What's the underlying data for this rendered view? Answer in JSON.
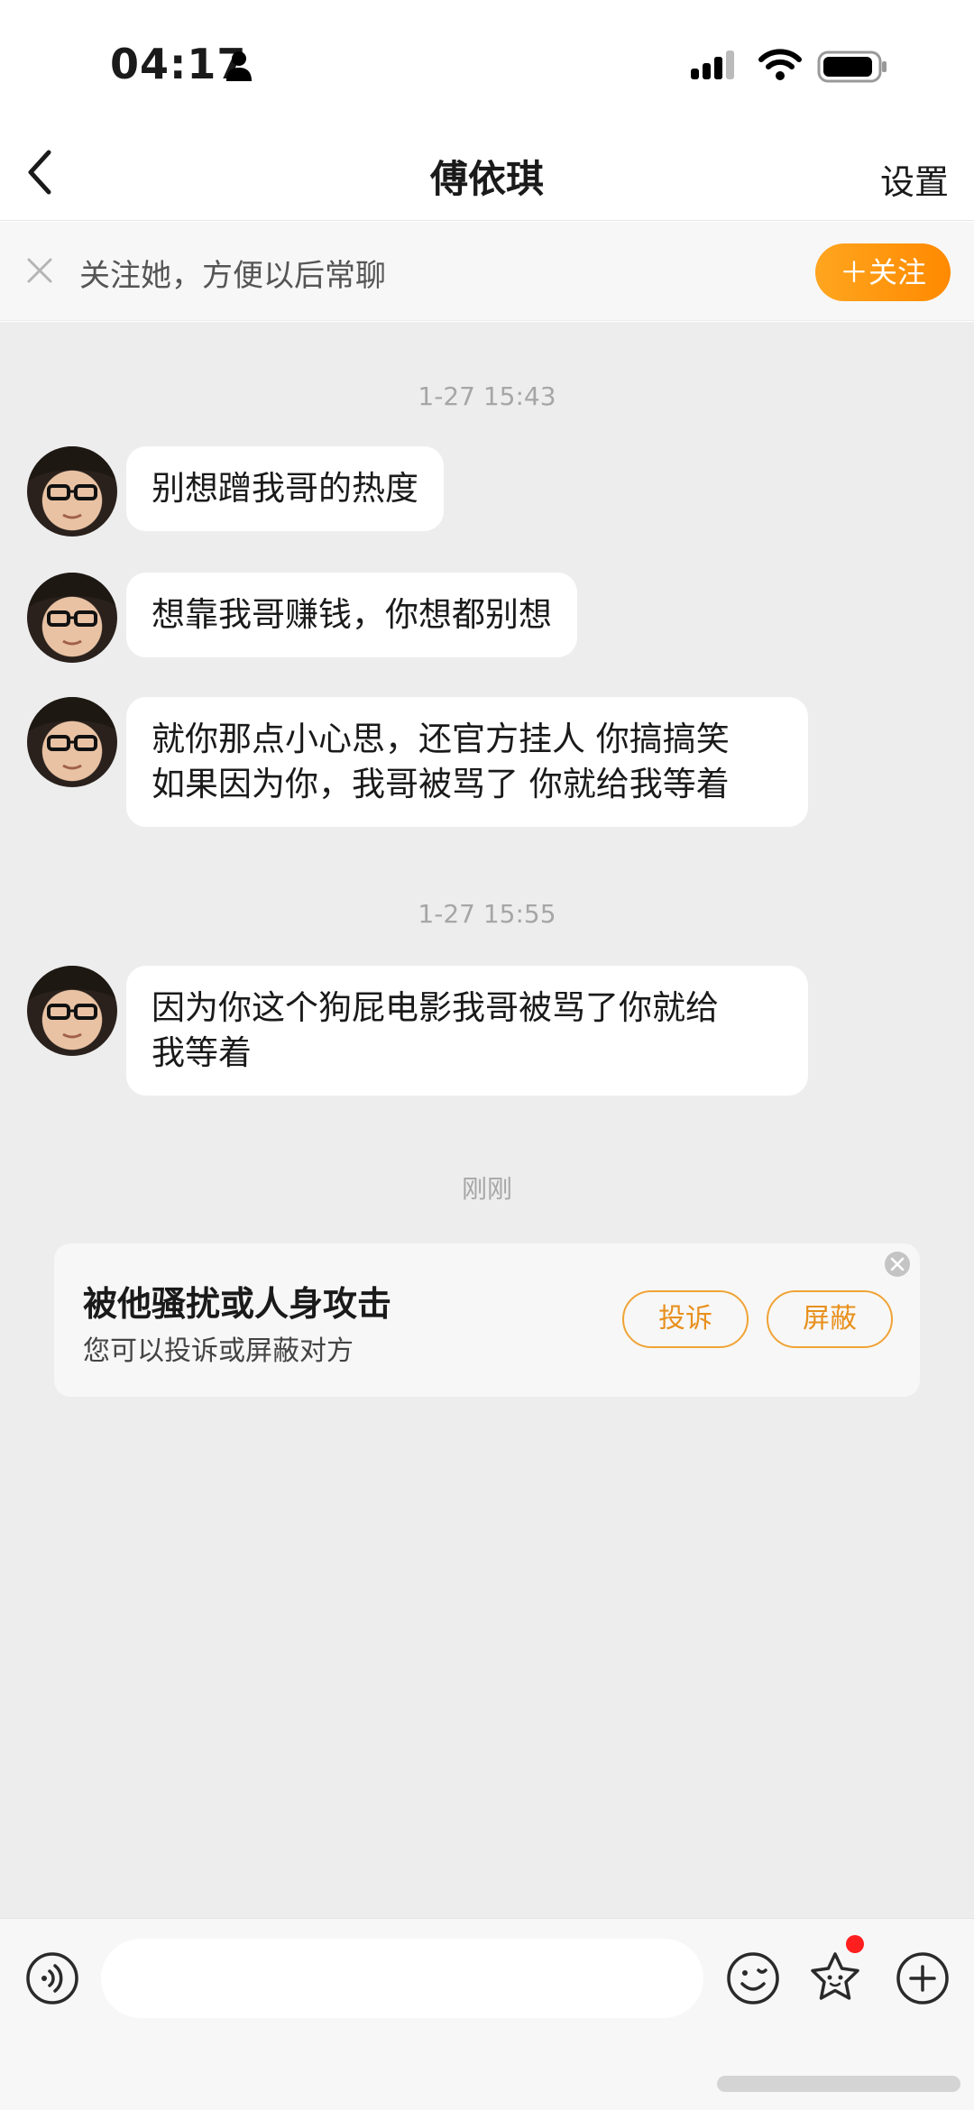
{
  "status_bar": {
    "time": "04:17",
    "icons": [
      "person-icon",
      "signal-icon",
      "wifi-icon",
      "battery-icon"
    ]
  },
  "nav": {
    "back_icon": "chevron-left-icon",
    "title": "傅依琪",
    "settings_label": "设置"
  },
  "follow_banner": {
    "text": "关注她，方便以后常聊",
    "button_label": "＋关注",
    "accent_color": "#ff9a0f"
  },
  "chat": {
    "background": "#ededed",
    "timestamps": {
      "t1": "1-27 15:43",
      "t2": "1-27 15:55",
      "t3": "刚刚"
    },
    "messages": [
      {
        "lines": [
          "别想蹭我哥的热度"
        ]
      },
      {
        "lines": [
          "想靠我哥赚钱，你想都别想"
        ]
      },
      {
        "lines": [
          "就你那点小心思，还官方挂人 你搞搞笑",
          "如果因为你，我哥被骂了 你就给我等着"
        ]
      },
      {
        "lines": [
          "因为你这个狗屁电影我哥被骂了你就给",
          "我等着"
        ]
      }
    ]
  },
  "harassment_card": {
    "title": "被他骚扰或人身攻击",
    "subtitle": "您可以投诉或屏蔽对方",
    "report_label": "投诉",
    "block_label": "屏蔽",
    "button_color": "#f0a335"
  },
  "input_bar": {
    "placeholder": "",
    "icons": [
      "voice-icon",
      "emoji-icon",
      "sticker-star-icon",
      "plus-icon"
    ],
    "notification_dot_color": "#ff1f1f"
  }
}
